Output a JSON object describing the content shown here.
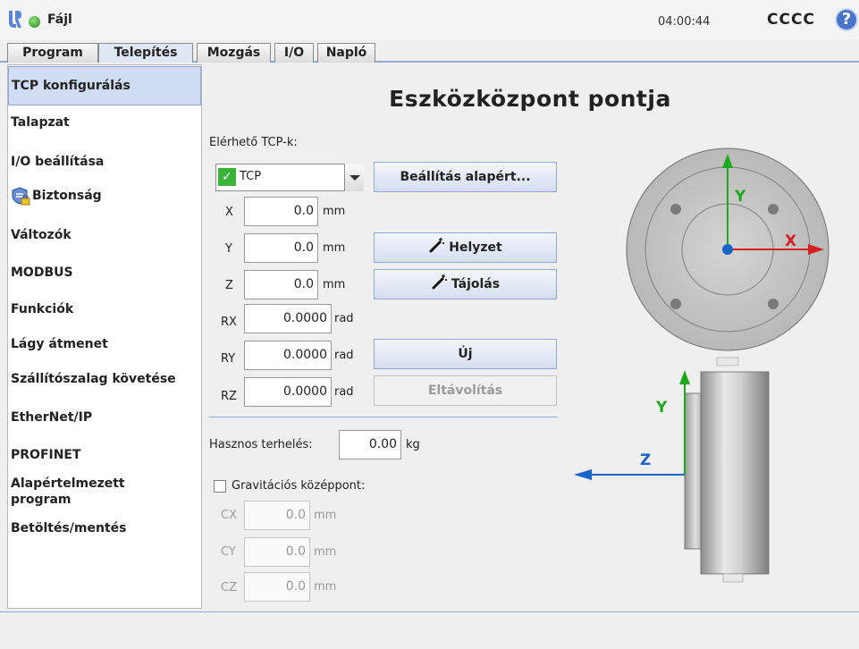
{
  "topbar": {
    "file_label": "Fájl",
    "clock": "04:00:44",
    "robot_name": "CCCC",
    "help": "?"
  },
  "tabs": [
    {
      "label": "Program"
    },
    {
      "label": "Telepítés"
    },
    {
      "label": "Mozgás"
    },
    {
      "label": "I/O"
    },
    {
      "label": "Napló"
    }
  ],
  "sidebar": {
    "items": [
      {
        "label": "TCP konfigurálás"
      },
      {
        "label": "Talapzat"
      },
      {
        "label": "I/O beállítása"
      },
      {
        "label": "Biztonság"
      },
      {
        "label": "Változók"
      },
      {
        "label": "MODBUS"
      },
      {
        "label": "Funkciók"
      },
      {
        "label": "Lágy átmenet"
      },
      {
        "label": "Szállítószalag követése"
      },
      {
        "label": "EtherNet/IP"
      },
      {
        "label": "PROFINET"
      },
      {
        "label": "Alapértelmezett program"
      },
      {
        "label": "Betöltés/mentés"
      }
    ]
  },
  "main": {
    "title": "Eszközközpont pontja",
    "available_tcps_label": "Elérhető TCP-k:",
    "tcp_selected": "TCP",
    "set_default_button": "Beállítás alapért...",
    "position_button": "Helyzet",
    "orientation_button": "Tájolás",
    "new_button": "Új",
    "remove_button": "Eltávolítás",
    "tcp_fields": [
      {
        "label": "X",
        "value": "0.0",
        "unit": "mm"
      },
      {
        "label": "Y",
        "value": "0.0",
        "unit": "mm"
      },
      {
        "label": "Z",
        "value": "0.0",
        "unit": "mm"
      },
      {
        "label": "RX",
        "value": "0.0000",
        "unit": "rad"
      },
      {
        "label": "RY",
        "value": "0.0000",
        "unit": "rad"
      },
      {
        "label": "RZ",
        "value": "0.0000",
        "unit": "rad"
      }
    ],
    "payload_label": "Hasznos terhelés:",
    "payload_value": "0.00",
    "payload_unit": "kg",
    "cog_label": "Gravitációs középpont:",
    "cog_checked": false,
    "cog_fields": [
      {
        "label": "CX",
        "value": "0.0",
        "unit": "mm"
      },
      {
        "label": "CY",
        "value": "0.0",
        "unit": "mm"
      },
      {
        "label": "CZ",
        "value": "0.0",
        "unit": "mm"
      }
    ],
    "axes": {
      "x": "X",
      "y": "Y",
      "z": "Z"
    }
  },
  "colors": {
    "accent": "#8faad6",
    "x_axis": "#d42020",
    "y_axis": "#1fa81f",
    "z_axis": "#1a64c8",
    "ok": "#3bb33b"
  }
}
